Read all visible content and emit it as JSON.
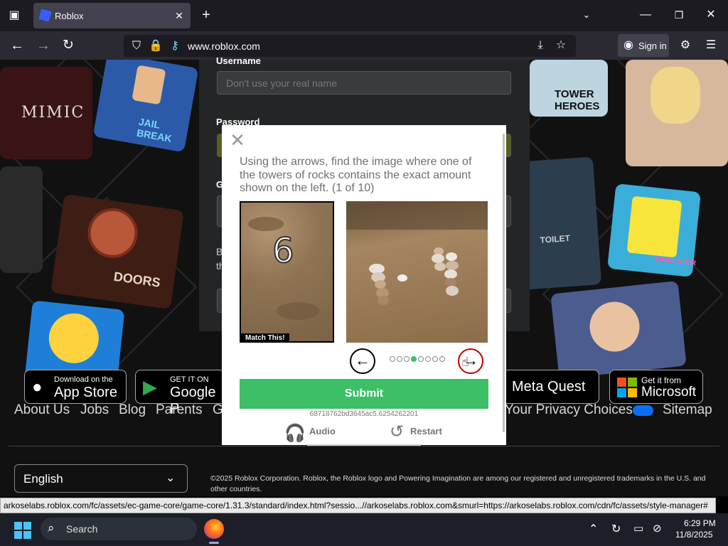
{
  "browser": {
    "tab_title": "Roblox",
    "url": "www.roblox.com",
    "sign_in_label": "Sign in"
  },
  "login": {
    "username_label": "Username",
    "username_placeholder": "Don't use your real name",
    "password_label": "Password",
    "letter_g": "G",
    "letter_b": "B",
    "letter_t": "th"
  },
  "background_titles": {
    "mimic": "MIMIC",
    "jailbreak": "JAIL BREAK",
    "doors": "DOORS",
    "tower_heroes": "TOWER HEROES",
    "toilet": "TOILET",
    "spongebob": "SIMULATOR"
  },
  "stores": {
    "apple_small": "Download on the",
    "apple_big": "App Store",
    "google_small": "GET IT ON",
    "google_big": "Google P",
    "meta_big": "Meta Quest",
    "ms_small": "Get it from",
    "ms_big": "Microsoft"
  },
  "footer": {
    "links": [
      "About Us",
      "Jobs",
      "Blog",
      "Parents",
      "G",
      "Your Privacy Choices",
      "Sitemap"
    ],
    "language": "English",
    "copyright": "©2025 Roblox Corporation. Roblox, the Roblox logo and Powering Imagination are among our registered and unregistered trademarks in the U.S. and other countries."
  },
  "captcha": {
    "instructions": "Using the arrows, find the image where one of the towers of rocks contains the exact amount shown on the left. (1 of 10)",
    "target_number": "6",
    "match_label": "Match This!",
    "dots_total": 8,
    "dots_active_index": 4,
    "submit_label": "Submit",
    "session_id": "68718762bd3645ac5.6254262201",
    "audio_label": "Audio",
    "restart_label": "Restart",
    "left_arrow": "←",
    "right_arrow": "→"
  },
  "status_url": "arkoselabs.roblox.com/fc/assets/ec-game-core/game-core/1.31.3/standard/index.html?sessio...//arkoselabs.roblox.com&smurl=https://arkoselabs.roblox.com/cdn/fc/assets/style-manager#",
  "taskbar": {
    "search_label": "Search",
    "time": "6:29 PM",
    "date": "11/8/2025"
  },
  "colors": {
    "submit_green": "#3cbf66",
    "active_dot": "#3cbf66",
    "arrow_highlight": "#c00000"
  }
}
